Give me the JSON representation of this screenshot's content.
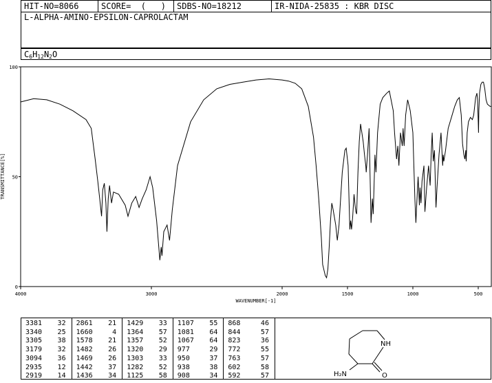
{
  "header": {
    "hit_no": "HIT-NO=8066",
    "score": "SCORE=  (   )",
    "sdbs_no": "SDBS-NO=18212",
    "ir_id": "IR-NIDA-25835 : KBR DISC"
  },
  "compound": {
    "name": "L-ALPHA-AMINO-EPSILON-CAPROLACTAM",
    "formula": {
      "c": "C",
      "c_n": "6",
      "h": "H",
      "h_n": "12",
      "n": "N",
      "n_n": "2",
      "o": "O"
    }
  },
  "chart_data": {
    "type": "line",
    "xlabel": "WAVENUMBER[-1]",
    "ylabel": "TRANSMITTANCE[%]",
    "xlim": [
      4000,
      400
    ],
    "ylim": [
      0,
      100
    ],
    "x_reversed": true,
    "x_ticks": [
      4000,
      3000,
      2000,
      1500,
      1000,
      500
    ],
    "y_ticks": [
      0,
      50,
      100
    ],
    "grid": false,
    "series": [
      {
        "points": [
          [
            4000,
            84
          ],
          [
            3900,
            85.5
          ],
          [
            3800,
            85
          ],
          [
            3700,
            83
          ],
          [
            3600,
            80
          ],
          [
            3500,
            76
          ],
          [
            3460,
            72
          ],
          [
            3430,
            58
          ],
          [
            3410,
            48
          ],
          [
            3395,
            40
          ],
          [
            3381,
            32
          ],
          [
            3372,
            44
          ],
          [
            3360,
            47
          ],
          [
            3348,
            38
          ],
          [
            3340,
            25
          ],
          [
            3330,
            40
          ],
          [
            3320,
            46
          ],
          [
            3305,
            38
          ],
          [
            3290,
            43
          ],
          [
            3250,
            42
          ],
          [
            3200,
            37
          ],
          [
            3179,
            32
          ],
          [
            3150,
            38
          ],
          [
            3120,
            41
          ],
          [
            3094,
            36
          ],
          [
            3070,
            40
          ],
          [
            3040,
            44
          ],
          [
            3010,
            50
          ],
          [
            2990,
            45
          ],
          [
            2960,
            30
          ],
          [
            2935,
            12
          ],
          [
            2925,
            18
          ],
          [
            2919,
            14
          ],
          [
            2905,
            25
          ],
          [
            2880,
            28
          ],
          [
            2861,
            21
          ],
          [
            2840,
            35
          ],
          [
            2800,
            55
          ],
          [
            2700,
            75
          ],
          [
            2600,
            85
          ],
          [
            2500,
            90
          ],
          [
            2400,
            92
          ],
          [
            2300,
            93
          ],
          [
            2200,
            94
          ],
          [
            2100,
            94.5
          ],
          [
            2000,
            94
          ],
          [
            1950,
            93.5
          ],
          [
            1900,
            92.5
          ],
          [
            1850,
            90
          ],
          [
            1800,
            82
          ],
          [
            1760,
            68
          ],
          [
            1740,
            55
          ],
          [
            1720,
            40
          ],
          [
            1700,
            22
          ],
          [
            1690,
            10
          ],
          [
            1670,
            5
          ],
          [
            1660,
            4
          ],
          [
            1650,
            8
          ],
          [
            1640,
            18
          ],
          [
            1630,
            30
          ],
          [
            1620,
            38
          ],
          [
            1610,
            35
          ],
          [
            1590,
            28
          ],
          [
            1578,
            21
          ],
          [
            1565,
            28
          ],
          [
            1555,
            38
          ],
          [
            1540,
            52
          ],
          [
            1520,
            62
          ],
          [
            1510,
            63
          ],
          [
            1495,
            55
          ],
          [
            1482,
            26
          ],
          [
            1476,
            30
          ],
          [
            1469,
            26
          ],
          [
            1460,
            32
          ],
          [
            1450,
            42
          ],
          [
            1442,
            37
          ],
          [
            1436,
            34
          ],
          [
            1430,
            33
          ],
          [
            1420,
            52
          ],
          [
            1410,
            66
          ],
          [
            1400,
            74
          ],
          [
            1390,
            70
          ],
          [
            1380,
            66
          ],
          [
            1370,
            60
          ],
          [
            1364,
            57
          ],
          [
            1360,
            55
          ],
          [
            1357,
            52
          ],
          [
            1345,
            62
          ],
          [
            1335,
            72
          ],
          [
            1320,
            29
          ],
          [
            1310,
            40
          ],
          [
            1303,
            33
          ],
          [
            1290,
            60
          ],
          [
            1282,
            52
          ],
          [
            1270,
            70
          ],
          [
            1250,
            83
          ],
          [
            1230,
            86
          ],
          [
            1200,
            88
          ],
          [
            1180,
            89
          ],
          [
            1150,
            80
          ],
          [
            1140,
            70
          ],
          [
            1125,
            58
          ],
          [
            1115,
            64
          ],
          [
            1107,
            55
          ],
          [
            1095,
            70
          ],
          [
            1081,
            64
          ],
          [
            1075,
            72
          ],
          [
            1067,
            64
          ],
          [
            1055,
            78
          ],
          [
            1040,
            85
          ],
          [
            1020,
            80
          ],
          [
            1000,
            70
          ],
          [
            985,
            40
          ],
          [
            977,
            29
          ],
          [
            970,
            38
          ],
          [
            960,
            50
          ],
          [
            950,
            37
          ],
          [
            945,
            45
          ],
          [
            938,
            38
          ],
          [
            930,
            48
          ],
          [
            915,
            55
          ],
          [
            908,
            34
          ],
          [
            895,
            45
          ],
          [
            880,
            55
          ],
          [
            868,
            46
          ],
          [
            860,
            60
          ],
          [
            852,
            70
          ],
          [
            844,
            57
          ],
          [
            835,
            62
          ],
          [
            823,
            36
          ],
          [
            815,
            45
          ],
          [
            800,
            60
          ],
          [
            785,
            70
          ],
          [
            772,
            55
          ],
          [
            768,
            60
          ],
          [
            763,
            57
          ],
          [
            750,
            62
          ],
          [
            730,
            72
          ],
          [
            700,
            78
          ],
          [
            680,
            82
          ],
          [
            660,
            85
          ],
          [
            645,
            86
          ],
          [
            630,
            78
          ],
          [
            620,
            65
          ],
          [
            610,
            60
          ],
          [
            602,
            58
          ],
          [
            595,
            62
          ],
          [
            592,
            57
          ],
          [
            585,
            70
          ],
          [
            575,
            75
          ],
          [
            560,
            77
          ],
          [
            545,
            76
          ],
          [
            535,
            78
          ],
          [
            520,
            86
          ],
          [
            510,
            88
          ],
          [
            505,
            85
          ],
          [
            500,
            75
          ],
          [
            498,
            70
          ],
          [
            495,
            80
          ],
          [
            490,
            88
          ],
          [
            480,
            92
          ],
          [
            470,
            93
          ],
          [
            460,
            93
          ],
          [
            450,
            90
          ],
          [
            440,
            85
          ],
          [
            430,
            83
          ],
          [
            420,
            82.5
          ],
          [
            410,
            82
          ],
          [
            400,
            82
          ]
        ]
      }
    ]
  },
  "peak_table": [
    [
      [
        "3381",
        "32"
      ],
      [
        "3340",
        "25"
      ],
      [
        "3305",
        "38"
      ],
      [
        "3179",
        "32"
      ],
      [
        "3094",
        "36"
      ],
      [
        "2935",
        "12"
      ],
      [
        "2919",
        "14"
      ]
    ],
    [
      [
        "2861",
        "21"
      ],
      [
        "1660",
        "4"
      ],
      [
        "1578",
        "21"
      ],
      [
        "1482",
        "26"
      ],
      [
        "1469",
        "26"
      ],
      [
        "1442",
        "37"
      ],
      [
        "1436",
        "34"
      ]
    ],
    [
      [
        "1429",
        "33"
      ],
      [
        "1364",
        "57"
      ],
      [
        "1357",
        "52"
      ],
      [
        "1320",
        "29"
      ],
      [
        "1303",
        "33"
      ],
      [
        "1282",
        "52"
      ],
      [
        "1125",
        "58"
      ]
    ],
    [
      [
        "1107",
        "55"
      ],
      [
        "1081",
        "64"
      ],
      [
        "1067",
        "64"
      ],
      [
        "977",
        "29"
      ],
      [
        "950",
        "37"
      ],
      [
        "938",
        "38"
      ],
      [
        "908",
        "34"
      ]
    ],
    [
      [
        "868",
        "46"
      ],
      [
        "844",
        "57"
      ],
      [
        "823",
        "36"
      ],
      [
        "772",
        "55"
      ],
      [
        "763",
        "57"
      ],
      [
        "602",
        "58"
      ],
      [
        "592",
        "57"
      ]
    ]
  ],
  "structure": {
    "nh_label": "NH",
    "o_label": "O",
    "nh2_label": "H₂N"
  }
}
